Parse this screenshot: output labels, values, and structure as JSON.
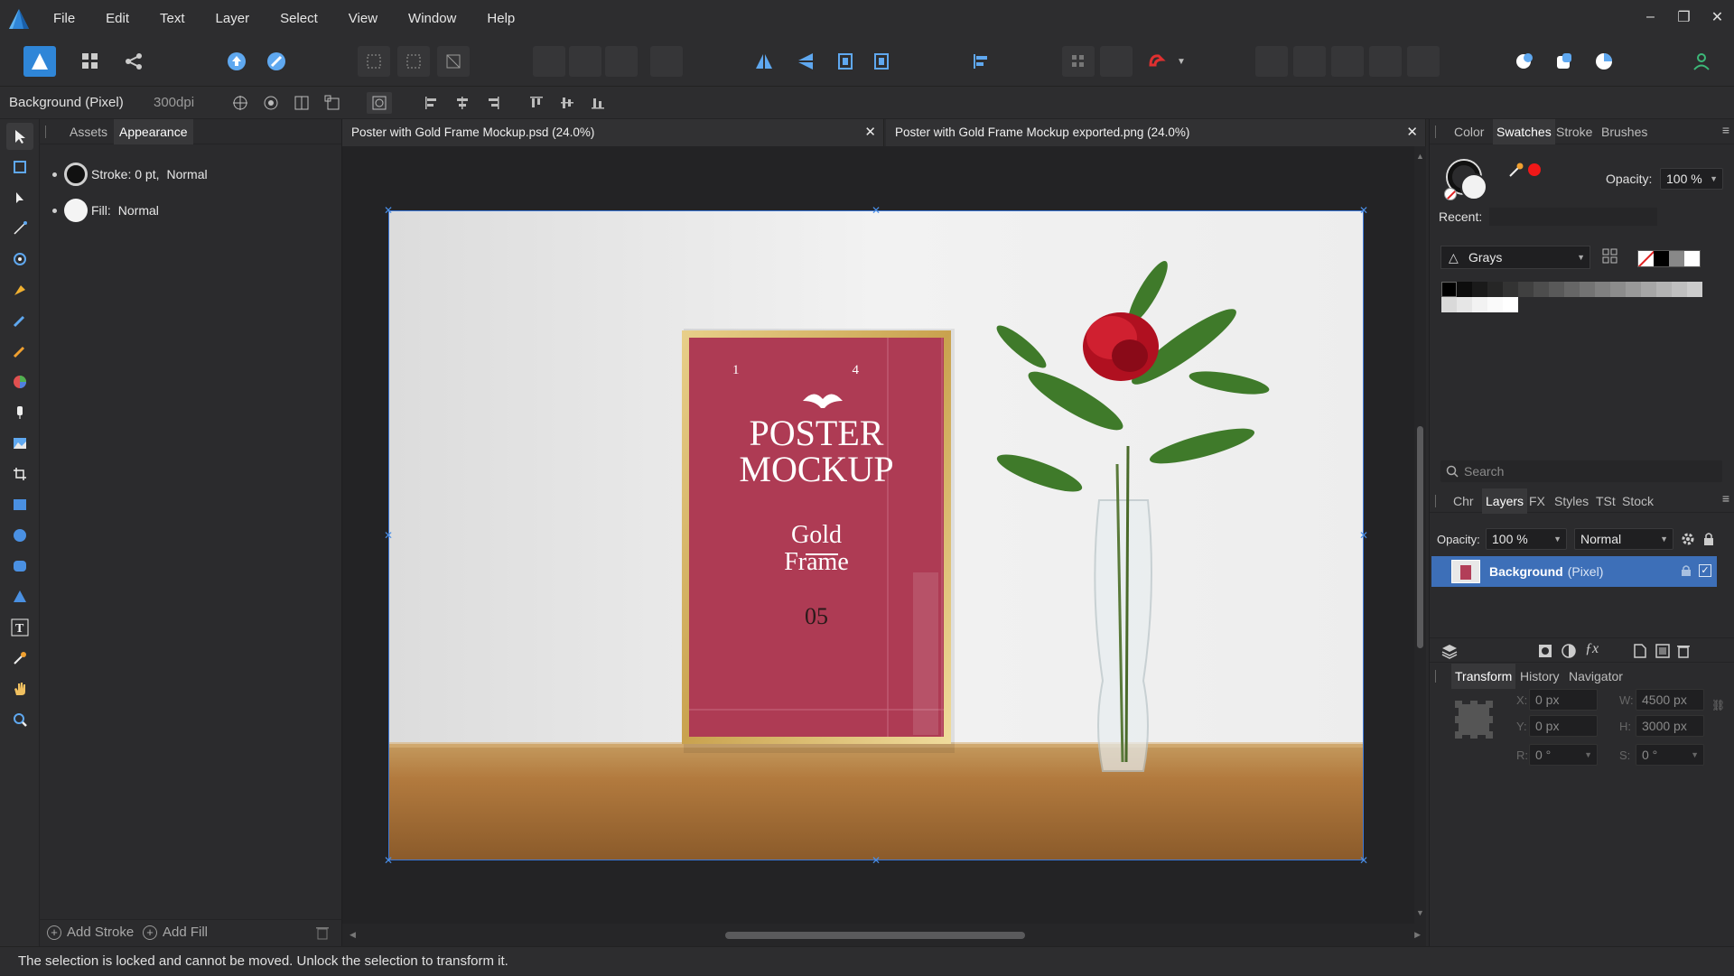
{
  "menu": {
    "items": [
      "File",
      "Edit",
      "Text",
      "Layer",
      "Select",
      "View",
      "Window",
      "Help"
    ]
  },
  "window": {
    "minimize": "–",
    "restore": "❐",
    "close": "✕"
  },
  "context": {
    "layer_label": "Background (Pixel)",
    "dpi": "300dpi"
  },
  "left_panel": {
    "tabs": [
      "Assets",
      "Appearance"
    ],
    "stroke_label": "Stroke: 0 pt,",
    "stroke_mode": "Normal",
    "fill_label": "Fill:",
    "fill_mode": "Normal",
    "add_stroke": "Add Stroke",
    "add_fill": "Add Fill"
  },
  "documents": [
    {
      "title": "Poster with Gold Frame Mockup.psd (24.0%)"
    },
    {
      "title": "Poster with Gold Frame Mockup exported.png (24.0%)"
    }
  ],
  "poster": {
    "left_num": "1",
    "right_num": "4",
    "line1": "POSTER",
    "line2": "MOCKUP",
    "sub1": "Gold",
    "sub2": "Frame",
    "number": "05"
  },
  "right_panel": {
    "top_tabs": [
      "Color",
      "Swatches",
      "Stroke",
      "Brushes"
    ],
    "opacity_label": "Opacity:",
    "opacity_value": "100 %",
    "recent_label": "Recent:",
    "palette": "Grays",
    "search_placeholder": "Search",
    "layer_tabs": [
      "Chr",
      "Layers",
      "FX",
      "Styles",
      "TSt",
      "Stock"
    ],
    "layers_opacity_label": "Opacity:",
    "layers_opacity_value": "100 %",
    "blend_mode": "Normal",
    "layer_name": "Background",
    "layer_type": "(Pixel)",
    "bottom_tabs": [
      "Transform",
      "History",
      "Navigator"
    ],
    "transform": {
      "x_label": "X:",
      "x": "0 px",
      "y_label": "Y:",
      "y": "0 px",
      "w_label": "W:",
      "w": "4500 px",
      "h_label": "H:",
      "h": "3000 px",
      "r_label": "R:",
      "r": "0 °",
      "s_label": "S:",
      "s": "0 °"
    }
  },
  "status": {
    "message": "The selection is locked and cannot be moved. Unlock the selection to transform it."
  }
}
